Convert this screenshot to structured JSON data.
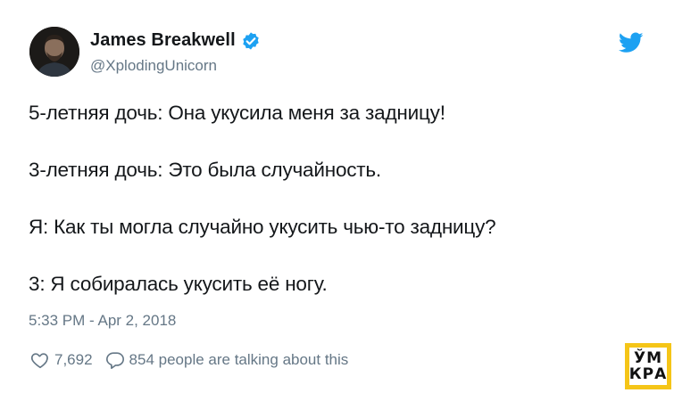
{
  "author": {
    "display_name": "James Breakwell",
    "handle": "@XplodingUnicorn",
    "verified": true,
    "avatar_icon": "avatar-photo"
  },
  "brand": {
    "icon": "twitter-bird-icon",
    "color": "#1da1f2"
  },
  "tweet": {
    "lines": [
      "5-летняя дочь: Она укусила меня за задницу!",
      "3-летняя дочь: Это была случайность.",
      "Я: Как ты могла случайно укусить чью-то задницу?",
      "3: Я собиралась укусить её ногу."
    ],
    "timestamp": "5:33 PM - Apr 2, 2018"
  },
  "actions": {
    "likes_count": "7,692",
    "replies_text": "854 people are talking about this",
    "like_icon": "heart-icon",
    "reply_icon": "reply-bubble-icon"
  },
  "watermark": {
    "line1": "ЎМ",
    "line2": "КРА",
    "color": "#f5c518"
  },
  "colors": {
    "text_primary": "#14171a",
    "text_secondary": "#657786",
    "verified_blue": "#1da1f2"
  }
}
